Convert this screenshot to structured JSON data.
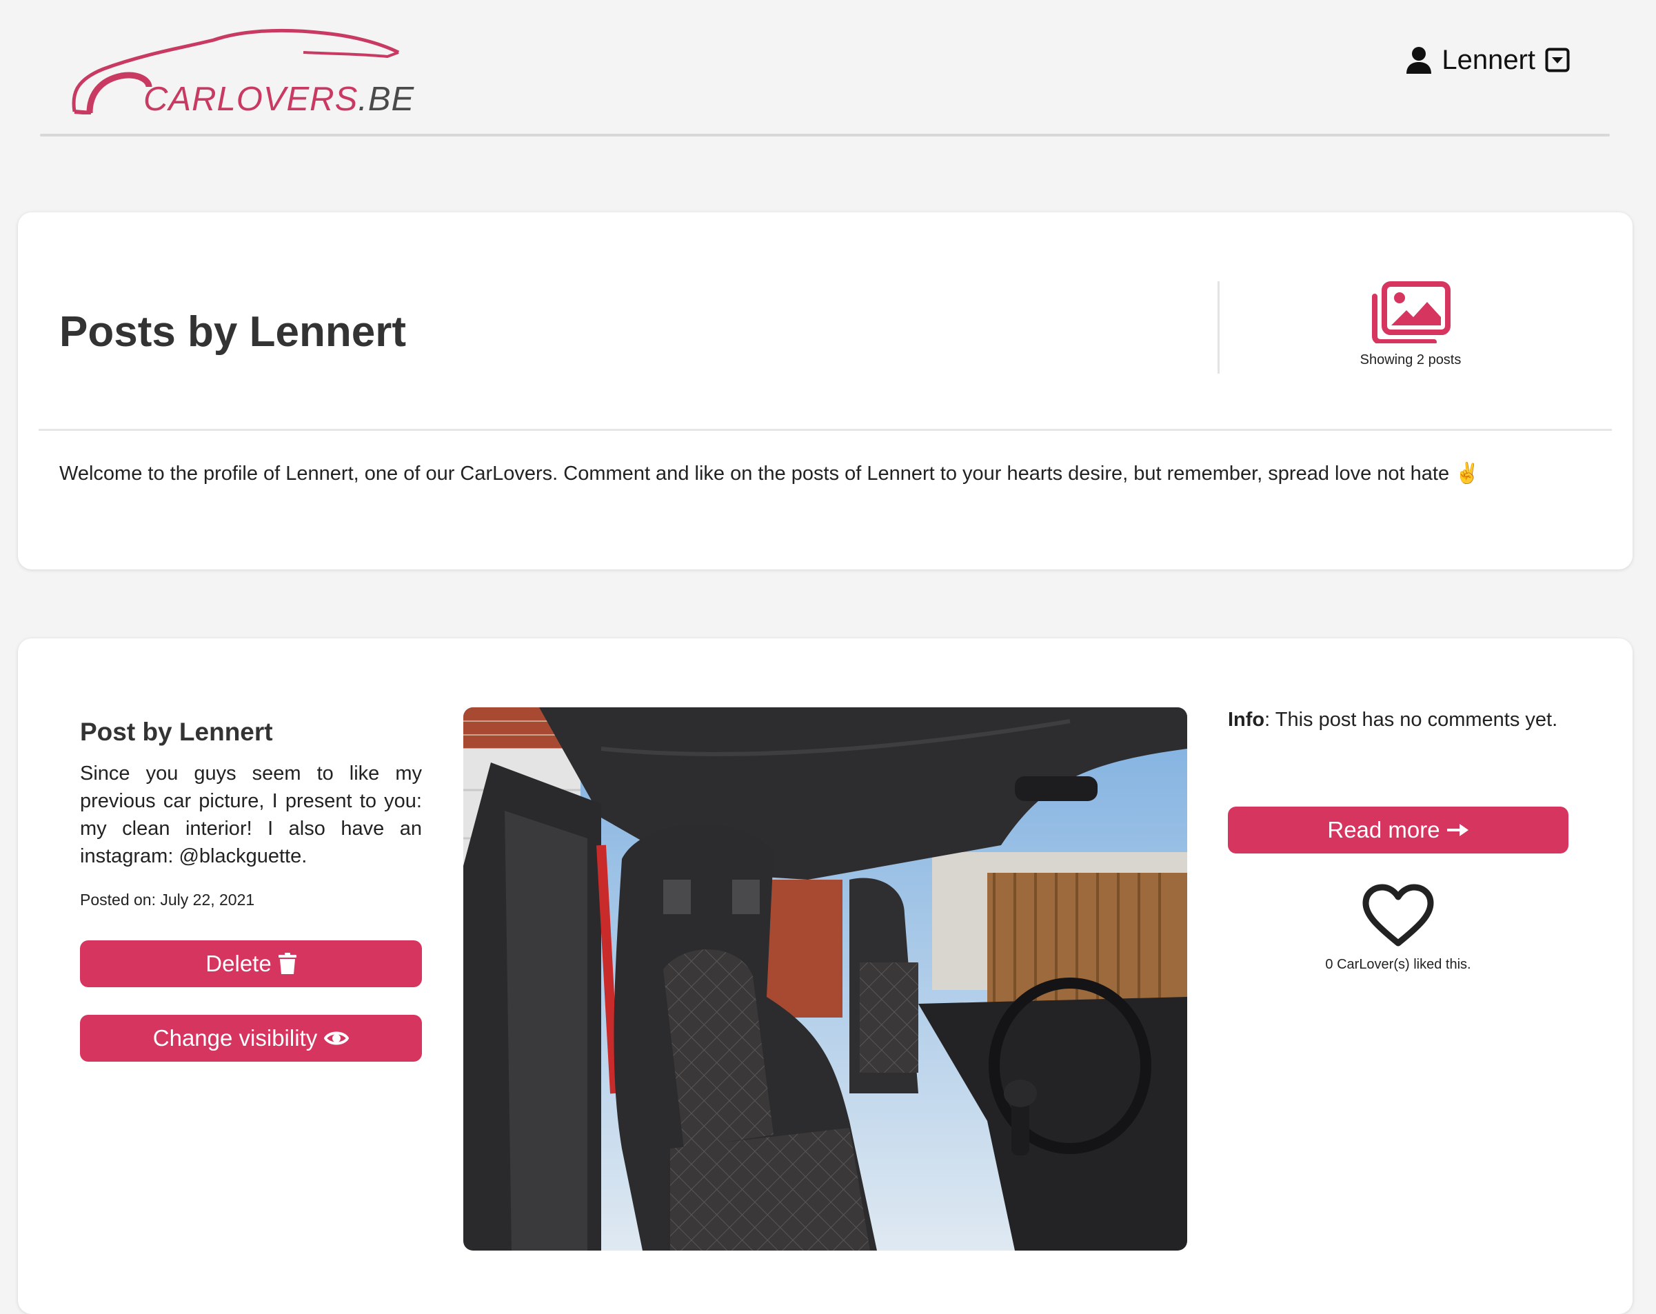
{
  "header": {
    "logo": {
      "brand": "CARLOVERS",
      "tld": ".BE"
    },
    "user_menu": {
      "username": "Lennert",
      "user_icon": "user-icon",
      "dropdown_icon": "caret-square-down-icon"
    }
  },
  "profile": {
    "title": "Posts by Lennert",
    "post_count_icon": "images-icon",
    "post_count_text": "Showing 2 posts",
    "welcome_text": "Welcome to the profile of Lennert, one of our CarLovers. Comment and like on the posts of Lennert to your hearts desire, but remember, spread love not hate ✌️"
  },
  "post": {
    "title": "Post by Lennert",
    "body": "Since you guys seem to like my previous car picture, I present to you: my clean interior! I also have an instagram: @blackguette.",
    "posted_on": "Posted on: July 22, 2021",
    "delete_label": "Delete",
    "delete_icon": "trash-icon",
    "visibility_label": "Change visibility",
    "visibility_icon": "eye-icon",
    "image_alt": "Car interior with black bucket seats",
    "info_label": "Info",
    "info_text": ": This post has no comments yet.",
    "read_more_label": "Read more",
    "read_more_icon": "arrow-right-icon",
    "like_icon": "heart-icon",
    "likes_text": "0 CarLover(s) liked this."
  },
  "colors": {
    "accent": "#d6355f",
    "logo": "#c93a63",
    "background": "#f4f4f4"
  }
}
